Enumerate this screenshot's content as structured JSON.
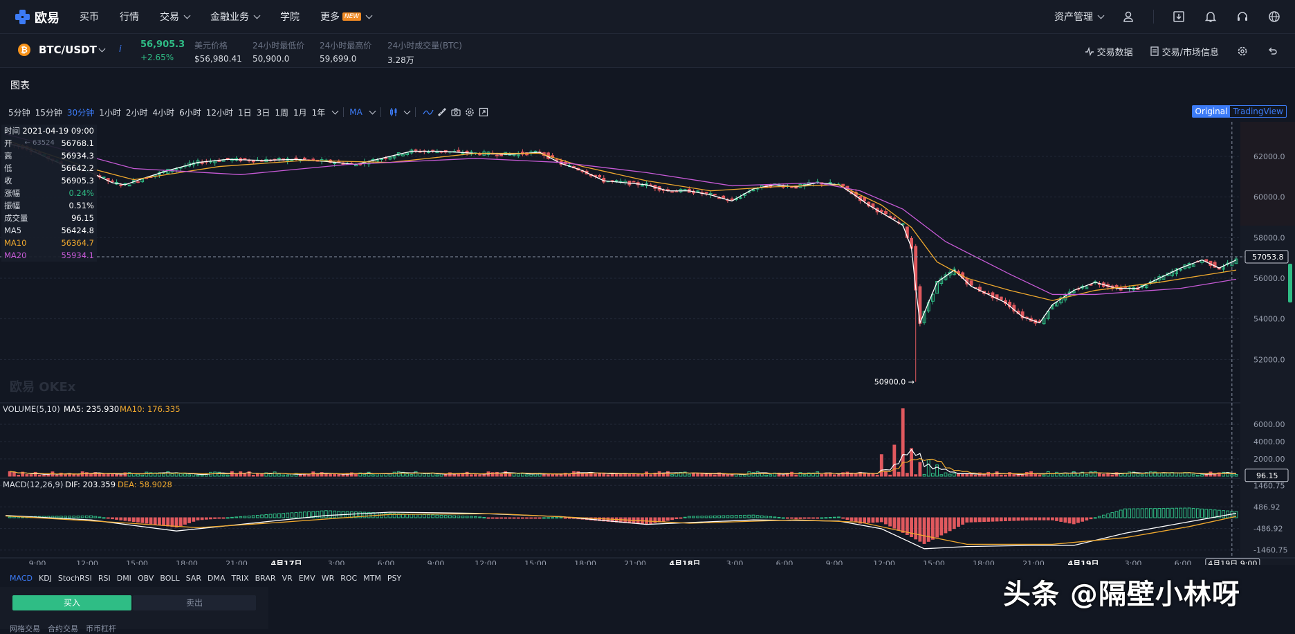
{
  "nav": {
    "brand": "欧易",
    "items": [
      "买币",
      "行情",
      "交易",
      "金融业务",
      "学院",
      "更多"
    ],
    "new_badge": "NEW",
    "asset_mgmt": "资产管理"
  },
  "ticker": {
    "pair": "BTC/USDT",
    "coin_symbol": "₿",
    "info": "i",
    "last": "56,905.3",
    "change": "+2.65%",
    "usd_label": "美元价格",
    "usd_value": "$56,980.41",
    "low_label": "24小时最低价",
    "low_value": "50,900.0",
    "high_label": "24小时最高价",
    "high_value": "59,699.0",
    "vol_label": "24小时成交量(BTC)",
    "vol_value": "3.28万",
    "trade_data": "交易数据",
    "market_info": "交易/市场信息"
  },
  "section_title": "图表",
  "timeframes": [
    "5分钟",
    "15分钟",
    "30分钟",
    "1小时",
    "2小时",
    "4小时",
    "6小时",
    "12小时",
    "1日",
    "3日",
    "1周",
    "1月",
    "1年"
  ],
  "active_timeframe": "30分钟",
  "indicator_select": "MA",
  "view_toggle": {
    "original": "Original",
    "tradingview": "TradingView"
  },
  "info_panel": {
    "time_label": "时间",
    "time": "2021-04-19 09:00",
    "open_label": "开",
    "open": "56768.1",
    "high_label": "高",
    "high": "56934.3",
    "low_label": "低",
    "low": "56642.2",
    "close_label": "收",
    "close": "56905.3",
    "chg_label": "涨幅",
    "chg": "0.24%",
    "amp_label": "振幅",
    "amp": "0.51%",
    "vol_label": "成交量",
    "vol": "96.15",
    "ma5_label": "MA5",
    "ma5": "56424.8",
    "ma10_label": "MA10",
    "ma10": "56364.7",
    "ma20_label": "MA20",
    "ma20": "55934.1",
    "hidden_hint": "← 63524"
  },
  "watermark": "欧易 OKEx",
  "volume_legend": {
    "title": "VOLUME(5,10)",
    "ma5": "MA5: 235.930",
    "ma10": "MA10: 176.335"
  },
  "macd_legend": {
    "title": "MACD(12,26,9)",
    "dif": "DIF: 203.359",
    "dea": "DEA: 58.9028"
  },
  "indicators_bar": [
    "MACD",
    "KDJ",
    "StochRSI",
    "RSI",
    "DMI",
    "OBV",
    "BOLL",
    "SAR",
    "DMA",
    "TRIX",
    "BRAR",
    "VR",
    "EMV",
    "WR",
    "ROC",
    "MTM",
    "PSY"
  ],
  "trade": {
    "buy": "买入",
    "sell": "卖出",
    "sub": "网格交易　合约交易　币币杠杆"
  },
  "overlay_text": "头条 @隔壁小林呀",
  "colors": {
    "up": "#2fbd85",
    "down": "#e0595e",
    "ma5": "#ffffff",
    "ma10": "#f0a92e",
    "ma20": "#c65ad6",
    "accent": "#3c7bf6"
  },
  "chart_data": {
    "type": "candlestick",
    "title": "BTC/USDT 30分钟",
    "x_ticks": [
      "9:00",
      "12:00",
      "15:00",
      "18:00",
      "21:00",
      "4月17日",
      "3:00",
      "6:00",
      "9:00",
      "12:00",
      "15:00",
      "18:00",
      "21:00",
      "4月18日",
      "3:00",
      "6:00",
      "9:00",
      "12:00",
      "15:00",
      "18:00",
      "21:00",
      "4月19日",
      "3:00",
      "6:00"
    ],
    "crosshair_time": "4月19日 9:00",
    "price_ticks": [
      "62000.0",
      "60000.0",
      "58000.0",
      "56000.0",
      "54000.0",
      "52000.0"
    ],
    "price_range": [
      50000,
      63700
    ],
    "last_price_label": "57053.8",
    "min_label": "50900.0 →",
    "close_path": [
      [
        0,
        62650
      ],
      [
        5,
        62400
      ],
      [
        10,
        61900
      ],
      [
        15,
        61450
      ],
      [
        20,
        61200
      ],
      [
        25,
        60700
      ],
      [
        28,
        60600
      ],
      [
        32,
        60900
      ],
      [
        38,
        61300
      ],
      [
        45,
        61700
      ],
      [
        52,
        61850
      ],
      [
        60,
        61800
      ],
      [
        68,
        61850
      ],
      [
        75,
        61750
      ],
      [
        82,
        61600
      ],
      [
        88,
        61900
      ],
      [
        95,
        62250
      ],
      [
        102,
        62250
      ],
      [
        110,
        62150
      ],
      [
        118,
        62100
      ],
      [
        125,
        62200
      ],
      [
        130,
        61650
      ],
      [
        135,
        61300
      ],
      [
        140,
        60800
      ],
      [
        145,
        60700
      ],
      [
        150,
        60600
      ],
      [
        155,
        60300
      ],
      [
        160,
        60300
      ],
      [
        165,
        60100
      ],
      [
        170,
        59800
      ],
      [
        175,
        60400
      ],
      [
        180,
        60600
      ],
      [
        185,
        60500
      ],
      [
        190,
        60700
      ],
      [
        195,
        60600
      ],
      [
        198,
        60200
      ],
      [
        202,
        59600
      ],
      [
        206,
        59100
      ],
      [
        210,
        58600
      ],
      [
        212,
        57500
      ],
      [
        213,
        55500
      ],
      [
        214,
        53800
      ],
      [
        216,
        54800
      ],
      [
        218,
        55800
      ],
      [
        222,
        56400
      ],
      [
        226,
        55600
      ],
      [
        230,
        55200
      ],
      [
        234,
        54800
      ],
      [
        238,
        54100
      ],
      [
        242,
        53800
      ],
      [
        245,
        54700
      ],
      [
        250,
        55400
      ],
      [
        255,
        55800
      ],
      [
        260,
        55500
      ],
      [
        265,
        55500
      ],
      [
        270,
        56000
      ],
      [
        275,
        56500
      ],
      [
        280,
        56900
      ],
      [
        284,
        56500
      ],
      [
        288,
        56900
      ]
    ],
    "ma10_path": [
      [
        0,
        62800
      ],
      [
        20,
        61400
      ],
      [
        30,
        60850
      ],
      [
        50,
        61500
      ],
      [
        70,
        61800
      ],
      [
        90,
        61700
      ],
      [
        110,
        62150
      ],
      [
        125,
        62150
      ],
      [
        135,
        61500
      ],
      [
        150,
        60800
      ],
      [
        165,
        60300
      ],
      [
        180,
        60500
      ],
      [
        195,
        60600
      ],
      [
        205,
        59600
      ],
      [
        212,
        58500
      ],
      [
        218,
        56800
      ],
      [
        225,
        56000
      ],
      [
        235,
        55400
      ],
      [
        245,
        54900
      ],
      [
        255,
        55400
      ],
      [
        270,
        55800
      ],
      [
        288,
        56400
      ]
    ],
    "ma20_path": [
      [
        0,
        63100
      ],
      [
        30,
        61400
      ],
      [
        55,
        61100
      ],
      [
        80,
        61600
      ],
      [
        110,
        61900
      ],
      [
        130,
        61700
      ],
      [
        150,
        61200
      ],
      [
        170,
        60550
      ],
      [
        190,
        60700
      ],
      [
        200,
        60300
      ],
      [
        210,
        59400
      ],
      [
        220,
        57800
      ],
      [
        235,
        56200
      ],
      [
        245,
        55200
      ],
      [
        255,
        55200
      ],
      [
        275,
        55500
      ],
      [
        288,
        55950
      ]
    ],
    "volume_ticks": [
      "6000.00",
      "4000.00",
      "2000.00"
    ],
    "volume_last": "96.15",
    "volume_spikes": [
      [
        205,
        2500
      ],
      [
        208,
        3600
      ],
      [
        210,
        7800
      ],
      [
        212,
        3200
      ],
      [
        214,
        1600
      ],
      [
        216,
        1900
      ],
      [
        218,
        1300
      ]
    ],
    "macd_ticks": [
      "1460.75",
      "486.92",
      "-486.92",
      "-1460.75"
    ],
    "dif_path": [
      [
        0,
        100
      ],
      [
        20,
        -100
      ],
      [
        40,
        -600
      ],
      [
        55,
        -300
      ],
      [
        75,
        100
      ],
      [
        90,
        250
      ],
      [
        110,
        200
      ],
      [
        130,
        50
      ],
      [
        150,
        -300
      ],
      [
        175,
        -100
      ],
      [
        195,
        -150
      ],
      [
        205,
        -500
      ],
      [
        215,
        -1400
      ],
      [
        225,
        -1300
      ],
      [
        240,
        -1250
      ],
      [
        250,
        -1250
      ],
      [
        262,
        -700
      ],
      [
        275,
        -250
      ],
      [
        288,
        200
      ]
    ],
    "dea_path": [
      [
        0,
        80
      ],
      [
        25,
        -200
      ],
      [
        45,
        -450
      ],
      [
        65,
        -200
      ],
      [
        90,
        150
      ],
      [
        115,
        180
      ],
      [
        140,
        -50
      ],
      [
        160,
        -250
      ],
      [
        185,
        -100
      ],
      [
        200,
        -200
      ],
      [
        212,
        -700
      ],
      [
        225,
        -1200
      ],
      [
        245,
        -1200
      ],
      [
        262,
        -900
      ],
      [
        277,
        -400
      ],
      [
        288,
        60
      ]
    ]
  }
}
